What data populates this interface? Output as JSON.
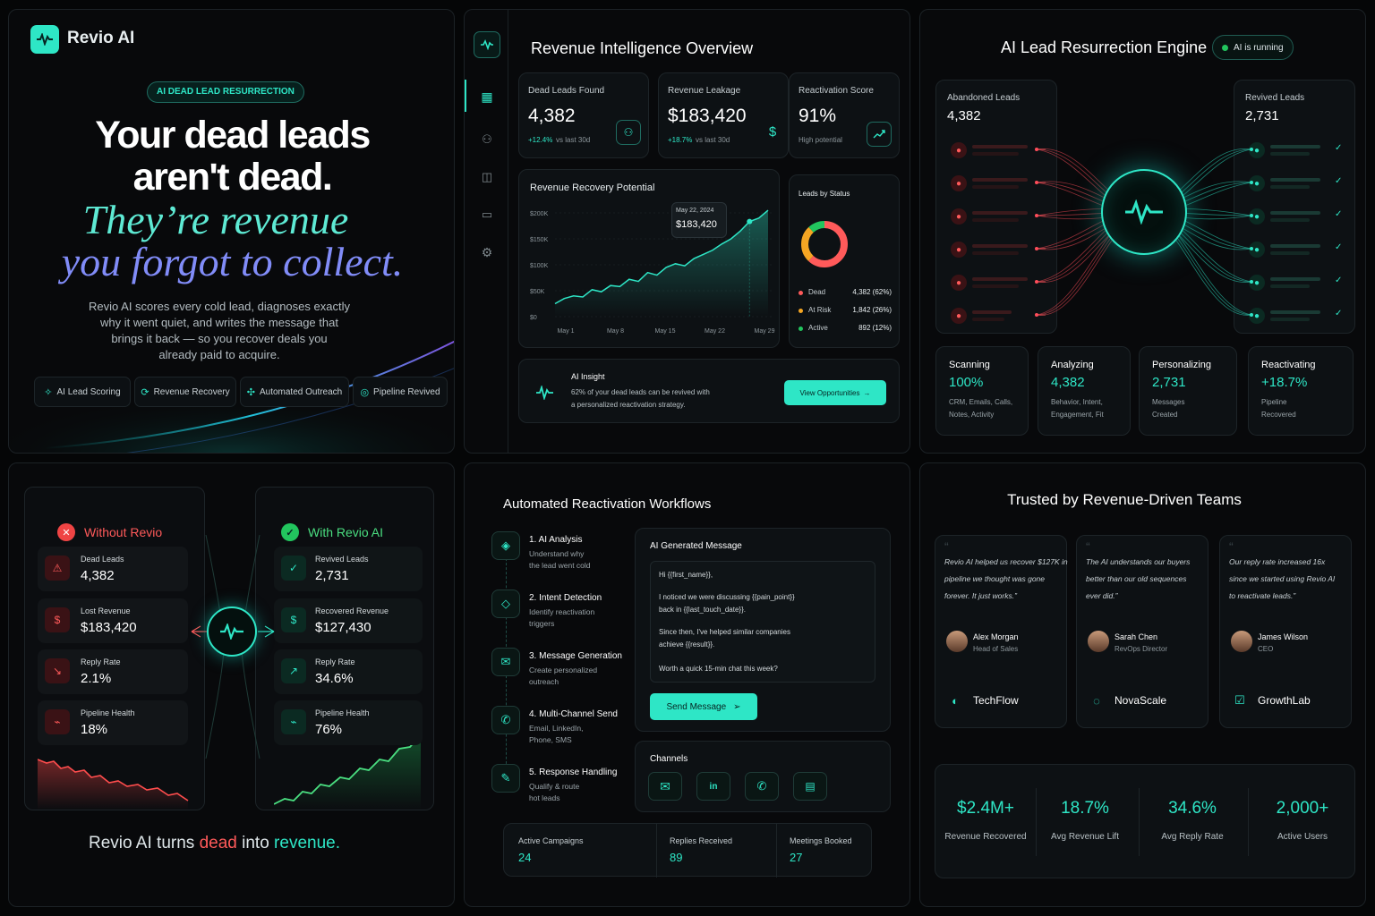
{
  "hero": {
    "brand": "Revio AI",
    "tag": "AI DEAD LEAD RESURRECTION",
    "h1_line1": "Your dead leads",
    "h1_line2": "aren't dead.",
    "script_line1": "They’re revenue",
    "script_line2": "you forgot to collect.",
    "desc_lines": [
      "Revio AI scores every cold lead, diagnoses exactly",
      "why it went quiet, and writes the message that",
      "brings it back — so you recover deals you",
      "already paid to acquire."
    ],
    "chips": [
      "AI Lead Scoring",
      "Revenue Recovery",
      "Automated Outreach",
      "Pipeline Revived"
    ]
  },
  "overview": {
    "title": "Revenue Intelligence Overview",
    "kpis": [
      {
        "label": "Dead Leads Found",
        "value": "4,382",
        "delta": "+12.4%",
        "note": "vs last 30d"
      },
      {
        "label": "Revenue Leakage",
        "value": "$183,420",
        "delta": "+18.7%",
        "note": "vs last 30d"
      },
      {
        "label": "Reactivation Score",
        "value": "91%",
        "note": "High potential"
      }
    ],
    "chart_title": "Revenue Recovery Potential",
    "tooltip_date": "May 22, 2024",
    "tooltip_value": "$183,420",
    "status_title": "Leads by Status",
    "status": [
      {
        "label": "Dead",
        "value": "4,382 (62%)",
        "color": "#ff5a5a"
      },
      {
        "label": "At Risk",
        "value": "1,842 (26%)",
        "color": "#f5a623"
      },
      {
        "label": "Active",
        "value": "892 (12%)",
        "color": "#22c55e"
      }
    ],
    "insight_title": "AI Insight",
    "insight_line1": "62% of your dead leads can be revived with",
    "insight_line2": "a personalized reactivation strategy.",
    "insight_button": "View Opportunities"
  },
  "chart_data": {
    "type": "area",
    "title": "Revenue Recovery Potential",
    "x": [
      "May 1",
      "May 8",
      "May 15",
      "May 22",
      "May 29"
    ],
    "y_ticks": [
      "$0",
      "$50K",
      "$100K",
      "$150K",
      "$200K"
    ],
    "ylim": [
      0,
      200000
    ],
    "points": [
      [
        0,
        25000
      ],
      [
        1,
        35000
      ],
      [
        2,
        40000
      ],
      [
        3,
        38000
      ],
      [
        4,
        52000
      ],
      [
        5,
        48000
      ],
      [
        6,
        60000
      ],
      [
        7,
        58000
      ],
      [
        8,
        72000
      ],
      [
        9,
        68000
      ],
      [
        10,
        85000
      ],
      [
        11,
        80000
      ],
      [
        12,
        95000
      ],
      [
        13,
        102000
      ],
      [
        14,
        98000
      ],
      [
        15,
        112000
      ],
      [
        16,
        120000
      ],
      [
        17,
        128000
      ],
      [
        18,
        140000
      ],
      [
        19,
        150000
      ],
      [
        20,
        165000
      ],
      [
        21,
        183420
      ],
      [
        22,
        190000
      ],
      [
        23,
        205000
      ]
    ],
    "highlight": {
      "date": "May 22, 2024",
      "value": 183420
    }
  },
  "engine": {
    "title": "AI Lead Resurrection Engine",
    "status": "AI is running",
    "left_label": "Abandoned Leads",
    "left_value": "4,382",
    "right_label": "Revived Leads",
    "right_value": "2,731",
    "stages": [
      {
        "label": "Scanning",
        "value": "100%",
        "d1": "CRM, Emails, Calls,",
        "d2": "Notes, Activity"
      },
      {
        "label": "Analyzing",
        "value": "4,382",
        "d1": "Behavior, Intent,",
        "d2": "Engagement, Fit"
      },
      {
        "label": "Personalizing",
        "value": "2,731",
        "d1": "Messages",
        "d2": "Created"
      },
      {
        "label": "Reactivating",
        "value": "+18.7%",
        "d1": "Pipeline",
        "d2": "Recovered"
      }
    ]
  },
  "compare": {
    "without_title": "Without Revio",
    "with_title": "With Revio AI",
    "without": [
      {
        "label": "Dead Leads",
        "value": "4,382"
      },
      {
        "label": "Lost Revenue",
        "value": "$183,420"
      },
      {
        "label": "Reply Rate",
        "value": "2.1%"
      },
      {
        "label": "Pipeline Health",
        "value": "18%"
      }
    ],
    "with": [
      {
        "label": "Revived Leads",
        "value": "2,731"
      },
      {
        "label": "Recovered Revenue",
        "value": "$127,430"
      },
      {
        "label": "Reply Rate",
        "value": "34.6%"
      },
      {
        "label": "Pipeline Health",
        "value": "76%"
      }
    ],
    "tagline_a": "Revio AI turns ",
    "tagline_b": "dead",
    "tagline_c": " into ",
    "tagline_d": "revenue."
  },
  "workflows": {
    "title": "Automated Reactivation Workflows",
    "steps": [
      {
        "t": "1. AI Analysis",
        "d1": "Understand why",
        "d2": "the lead went cold"
      },
      {
        "t": "2. Intent Detection",
        "d1": "Identify reactivation",
        "d2": "triggers"
      },
      {
        "t": "3. Message Generation",
        "d1": "Create personalized",
        "d2": "outreach"
      },
      {
        "t": "4. Multi-Channel Send",
        "d1": "Email, LinkedIn,",
        "d2": "Phone, SMS"
      },
      {
        "t": "5. Response Handling",
        "d1": "Qualify & route",
        "d2": "hot leads"
      }
    ],
    "msg_title": "AI Generated Message",
    "msg": [
      "Hi {{first_name}},",
      "I noticed we were discussing {{pain_point}}",
      "back in {{last_touch_date}}.",
      "Since then, I've helped similar companies",
      "achieve {{result}}.",
      "Worth a quick 15-min chat this week?"
    ],
    "send": "Send Message",
    "channels_title": "Channels",
    "stats": [
      {
        "label": "Active Campaigns",
        "value": "24"
      },
      {
        "label": "Replies Received",
        "value": "89"
      },
      {
        "label": "Meetings Booked",
        "value": "27"
      }
    ]
  },
  "trust": {
    "title": "Trusted by Revenue-Driven Teams",
    "quotes": [
      {
        "lines": [
          "Revio AI helped us recover $127K in",
          "pipeline we thought was gone",
          "forever. It just works.”"
        ],
        "name": "Alex Morgan",
        "role": "Head of Sales",
        "company": "TechFlow"
      },
      {
        "lines": [
          "The AI understands our buyers",
          "better than our old sequences",
          "ever did.”"
        ],
        "name": "Sarah Chen",
        "role": "RevOps Director",
        "company": "NovaScale"
      },
      {
        "lines": [
          "Our reply rate increased 16x",
          "since we started using Revio AI",
          "to reactivate leads.”"
        ],
        "name": "James Wilson",
        "role": "CEO",
        "company": "GrowthLab"
      }
    ],
    "stats": [
      {
        "value": "$2.4M+",
        "label": "Revenue Recovered"
      },
      {
        "value": "18.7%",
        "label": "Avg Revenue Lift"
      },
      {
        "value": "34.6%",
        "label": "Avg Reply Rate"
      },
      {
        "value": "2,000+",
        "label": "Active Users"
      }
    ]
  },
  "colors": {
    "accent": "#2ee6c6",
    "danger": "#ff5a5a",
    "panel": "#08090b"
  }
}
